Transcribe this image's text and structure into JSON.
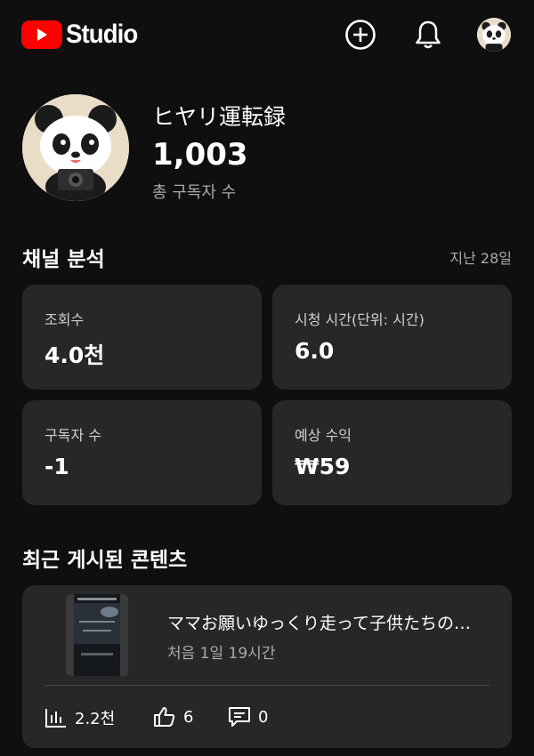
{
  "header": {
    "app_name": "Studio",
    "icons": [
      "create-icon",
      "notifications-icon",
      "account-avatar"
    ]
  },
  "channel": {
    "name": "ヒヤリ運転録",
    "subscriber_count": "1,003",
    "subscriber_label": "총 구독자 수"
  },
  "analytics": {
    "title": "채널 분석",
    "period": "지난 28일",
    "cards": [
      {
        "label": "조회수",
        "value": "4.0천"
      },
      {
        "label": "시청 시간(단위: 시간)",
        "value": "6.0"
      },
      {
        "label": "구독자 수",
        "value": "-1"
      },
      {
        "label": "예상 수익",
        "value": "₩59"
      }
    ]
  },
  "recent": {
    "title": "최근 게시된 콘텐츠",
    "video": {
      "title": "ママお願いゆっくり走って子供たちの…",
      "meta": "처음 1일 19시간",
      "views": "2.2천",
      "likes": "6",
      "comments": "0"
    }
  },
  "colors": {
    "background": "#0f0f0f",
    "card": "#272727",
    "brand_red": "#ff0000",
    "secondary_text": "#aaaaaa"
  }
}
